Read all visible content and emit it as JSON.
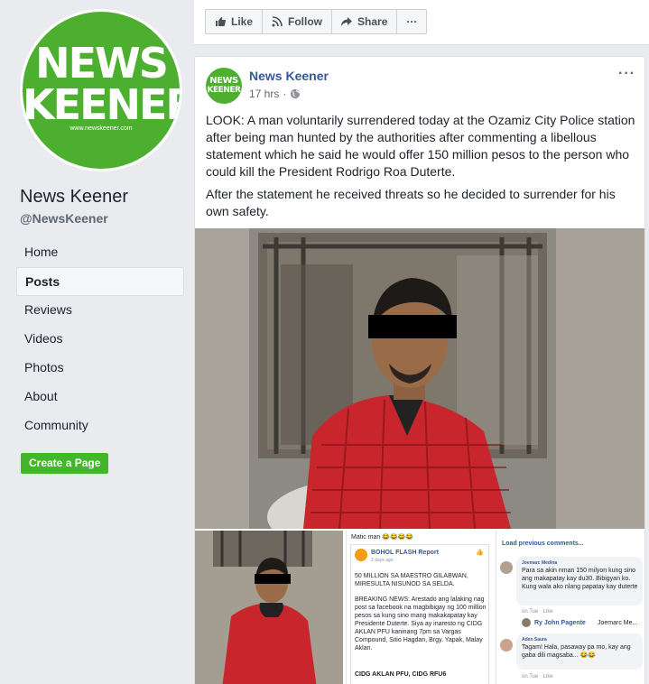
{
  "sidebar": {
    "logo_line1": "NEWS",
    "logo_line2": "KEENER",
    "logo_url": "www.newskeener.com",
    "page_name": "News Keener",
    "page_handle": "@NewsKeener",
    "nav": [
      "Home",
      "Posts",
      "Reviews",
      "Videos",
      "Photos",
      "About",
      "Community"
    ],
    "active_nav": "Posts",
    "create_page": "Create a Page"
  },
  "actions": {
    "like": "Like",
    "follow": "Follow",
    "share": "Share",
    "more": "···"
  },
  "post": {
    "avatar_l1": "NEWS",
    "avatar_l2": "KEENER",
    "author": "News Keener",
    "time": "17 hrs",
    "dot": "·",
    "more": "···",
    "paragraph1": "LOOK: A man voluntarily surrendered today at the Ozamiz City Police station after being man hunted by the authorities after commenting a libellous statement which he said he would offer 150 million pesos to the person who could kill the President Rodrigo Roa Duterte.",
    "paragraph2": "After the statement he received threats so he decided to surrender for his own safety."
  },
  "thumb2": {
    "caption": "Matic man 😂😂😂😂",
    "page": "BOHOL FLASH Report",
    "time": "2 days ago",
    "headline": "50 MILLION SA MAESTRO GILABWAN, MIRESULTA NISUNOD SA SELDA.",
    "body": "BREAKING NEWS: Arestado ang lalaking nag post sa facebook na magbibigay ng 100 million pesos sa kung sino mang makakapatay kay Presidente Duterte. Siya ay inaresto ng CIDG AKLAN PFU kaninang 7pm sa Vargas Compound, Sitio Hagdan, Brgy. Yapak, Malay Aklan.",
    "footer": "CIDG AKLAN PFU, CIDG RFU6"
  },
  "thumb3": {
    "load_more": "Load previous comments...",
    "c1_name": "Joemarc Medina",
    "c1_text": "Para sa akin nman 150 milyon kung sino ang makapatay kay du30. Bibigyan ko. Kung wala ako nlang papatay kay duterte",
    "c1_meta": "on Tue · Like",
    "reply_name": "Ry John Pagente",
    "reply_text": "Joemarc Me...",
    "c2_name": "Aden Saura",
    "c2_text": "Tagam! Hala, pasaway pa mo, kay ang gaba dili magsaba... 😂😂",
    "c2_meta": "on Tue · Like"
  },
  "colors": {
    "brand_green": "#4caf2f",
    "link_blue": "#365899",
    "create_green": "#42b72a",
    "shirt_red": "#c8262c"
  }
}
